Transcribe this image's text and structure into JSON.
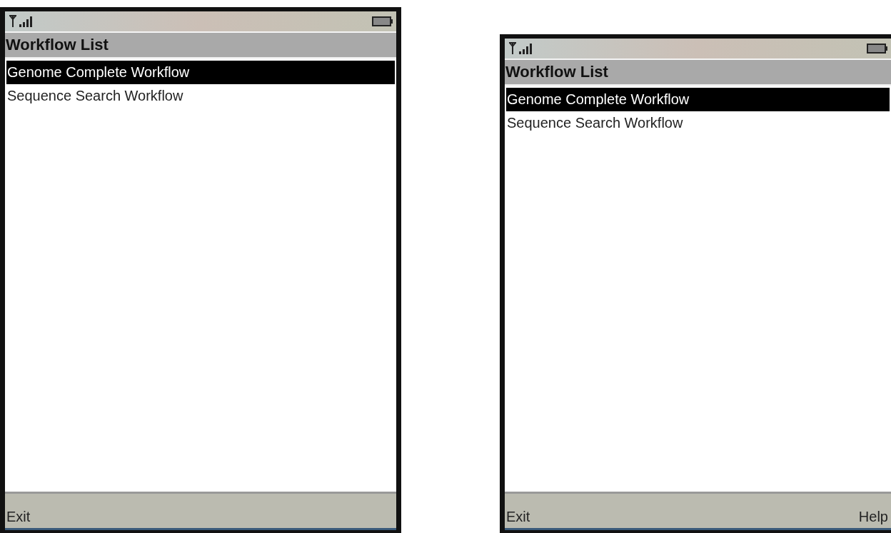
{
  "screens": [
    {
      "title": "Workflow List",
      "items": [
        {
          "label": "Genome Complete Workflow",
          "selected": true
        },
        {
          "label": "Sequence Search Workflow",
          "selected": false
        }
      ],
      "left_key": "Exit"
    },
    {
      "title": "Workflow List",
      "items": [
        {
          "label": "Genome Complete Workflow",
          "selected": true
        },
        {
          "label": "Sequence Search Workflow",
          "selected": false
        }
      ],
      "left_key": "Exit",
      "right_key": "Help"
    }
  ]
}
